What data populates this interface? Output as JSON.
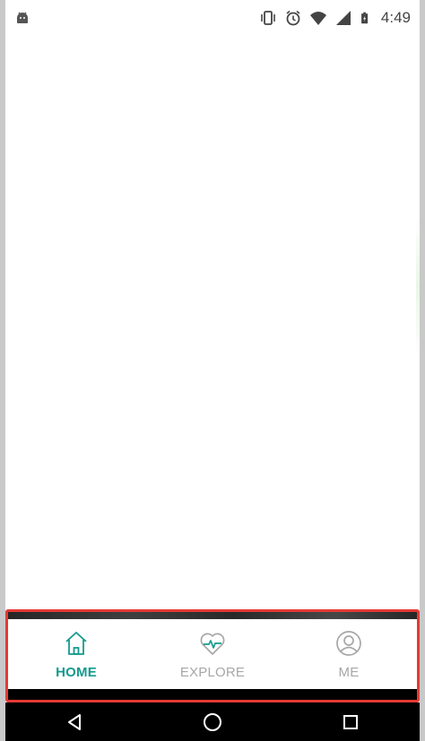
{
  "status_bar": {
    "time": "4:49",
    "icons": [
      "android-debug-icon",
      "vibrate-icon",
      "alarm-icon",
      "wifi-icon",
      "signal-icon",
      "battery-charging-icon"
    ]
  },
  "tabs": [
    {
      "label": "HOME",
      "icon": "home-icon",
      "active": true
    },
    {
      "label": "EXPLORE",
      "icon": "heart-pulse-icon",
      "active": false
    },
    {
      "label": "ME",
      "icon": "person-icon",
      "active": false
    }
  ],
  "colors": {
    "accent": "#159a8f",
    "inactive": "#a7a7a7",
    "highlight_border": "#e53935",
    "nav_bar": "#000000"
  },
  "nav_bar": {
    "buttons": [
      "back-icon",
      "home-circle-icon",
      "recents-icon"
    ]
  }
}
